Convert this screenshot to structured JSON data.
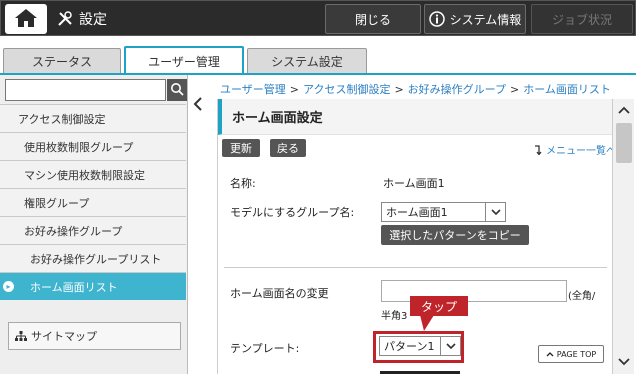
{
  "topbar": {
    "home_icon": "home-icon",
    "settings_label": "設定",
    "settings_icon": "tools-icon",
    "close_label": "閉じる",
    "system_info_label": "システム情報",
    "system_info_icon": "info-icon",
    "job_status_label": "ジョブ状況"
  },
  "tabs": [
    {
      "label": "ステータス",
      "active": false
    },
    {
      "label": "ユーザー管理",
      "active": true
    },
    {
      "label": "システム設定",
      "active": false
    }
  ],
  "sidebar": {
    "search_placeholder": "",
    "search_icon": "search-icon",
    "items": [
      {
        "label": "アクセス制御設定",
        "active": false
      },
      {
        "label": "使用枚数制限グループ",
        "active": false
      },
      {
        "label": "マシン使用枚数制限設定",
        "active": false
      },
      {
        "label": "権限グループ",
        "active": false
      },
      {
        "label": "お好み操作グループ",
        "active": false
      },
      {
        "label": "お好み操作グループリスト",
        "active": false
      },
      {
        "label": "ホーム画面リスト",
        "active": true
      }
    ],
    "sitemap_label": "サイトマップ"
  },
  "breadcrumb": [
    "ユーザー管理",
    "アクセス制御設定",
    "お好み操作グループ",
    "ホーム画面リスト"
  ],
  "panel": {
    "title": "ホーム画面設定",
    "update_label": "更新",
    "back_label": "戻る",
    "menu_list_label": "メニュー一覧へ",
    "name_label": "名称:",
    "name_value": "ホーム画面1",
    "model_group_label": "モデルにするグループ名:",
    "model_group_value": "ホーム画面1",
    "copy_button_label": "選択したパターンをコピー",
    "rename_label": "ホーム画面名の変更",
    "rename_value": "",
    "rename_hint_1": "(全角/",
    "rename_hint_2": "半角3",
    "template_label": "テンプレート:",
    "template_value": "パターン1",
    "page_top_label": "PAGE TOP"
  },
  "annotation": {
    "callout_label": "タップ",
    "highlight_color": "#c0242b"
  },
  "colors": {
    "accent": "#1ea3c4",
    "active_nav": "#3fb4cf",
    "link": "#2b7fc2",
    "topbar": "#2b2b2b"
  }
}
